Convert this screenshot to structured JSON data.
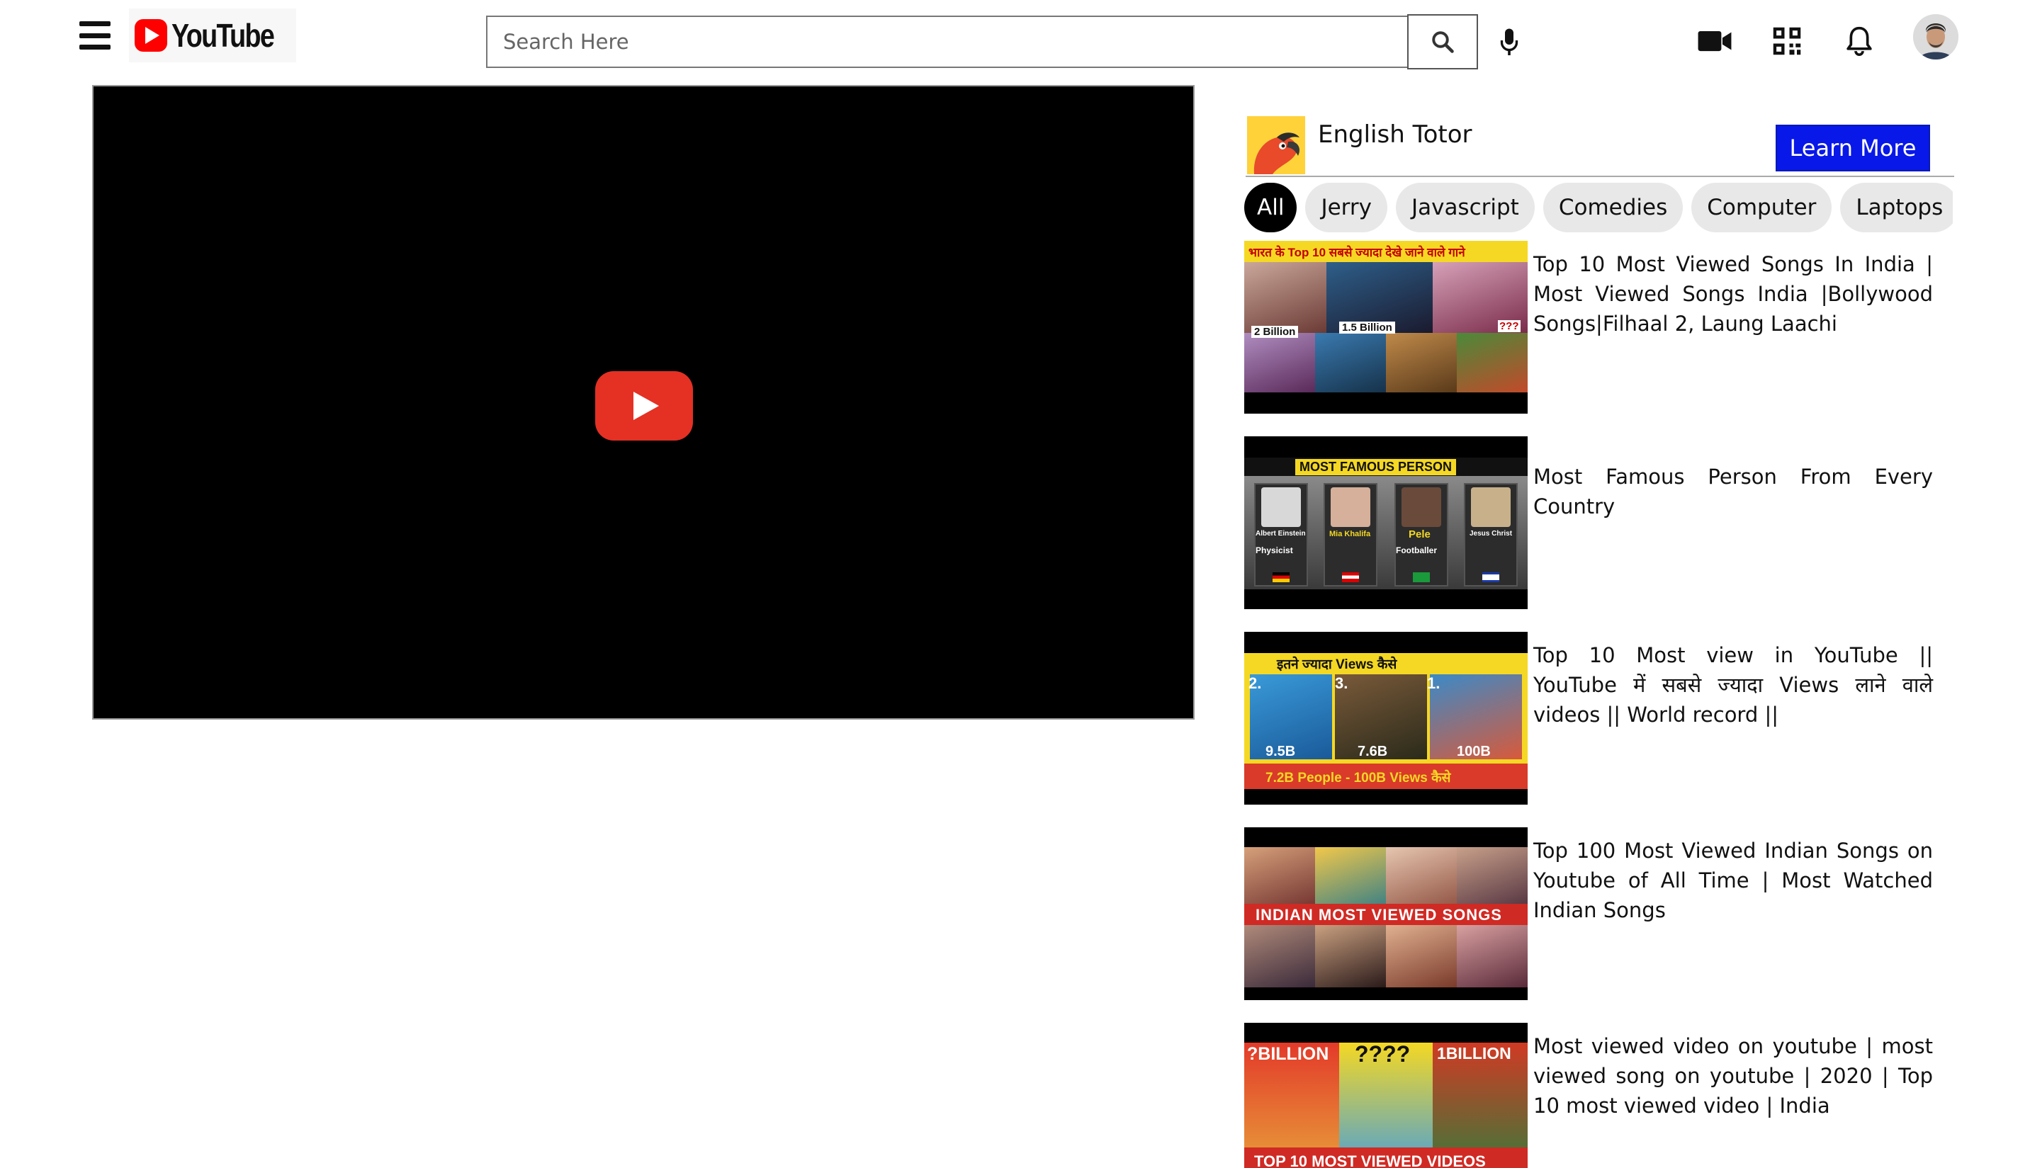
{
  "header": {
    "logo_text": "YouTube",
    "search_placeholder": "Search Here"
  },
  "ad": {
    "title": "English Totor",
    "button_label": "Learn More"
  },
  "chips": [
    "All",
    "Jerry",
    "Javascript",
    "Comedies",
    "Computer",
    "Laptops"
  ],
  "recommendations": [
    {
      "title": "Top 10 Most Viewed Songs In India | Most Viewed Songs India |Bollywood Songs|Filhaal 2, Laung Laachi",
      "thumb_text": [
        "भारत के Top 10 सबसे ज्यादा देखे जाने वाले गाने",
        "2 Billion",
        "1.5 Billion",
        "???"
      ]
    },
    {
      "title": "Most Famous Person From Every Country",
      "thumb_text": [
        "MOST FAMOUS PERSON",
        "Albert Einstein",
        "Mia Khalifa",
        "Pele",
        "Jesus Christ",
        "Physicist",
        "Footballer"
      ]
    },
    {
      "title": "Top 10 Most view in YouTube || YouTube में सबसे ज्यादा Views लाने वाले videos || World record ||",
      "thumb_text": [
        "इतने ज्यादा Views कैसे",
        "2.",
        "3.",
        "1.",
        "9.5B",
        "7.6B",
        "100B",
        "7.2B People - 100B Views कैसे"
      ]
    },
    {
      "title": "Top 100 Most Viewed Indian Songs on Youtube of All Time | Most Watched Indian Songs",
      "thumb_text": [
        "INDIAN MOST VIEWED SONGS"
      ]
    },
    {
      "title": "Most viewed video on youtube | most viewed song on youtube | 2020 | Top 10 most viewed video | India",
      "thumb_text": [
        "?BILLION",
        "????",
        "1BILLION",
        "TOP 10 MOST VIEWED VIDEOS"
      ]
    }
  ],
  "colors": {
    "brand_red": "#ff0000",
    "learn_more_blue": "#0818e8",
    "active_chip": "#000000"
  },
  "icons": [
    "menu-icon",
    "search-icon",
    "mic-icon",
    "video-camera-icon",
    "qr-code-icon",
    "bell-icon"
  ]
}
